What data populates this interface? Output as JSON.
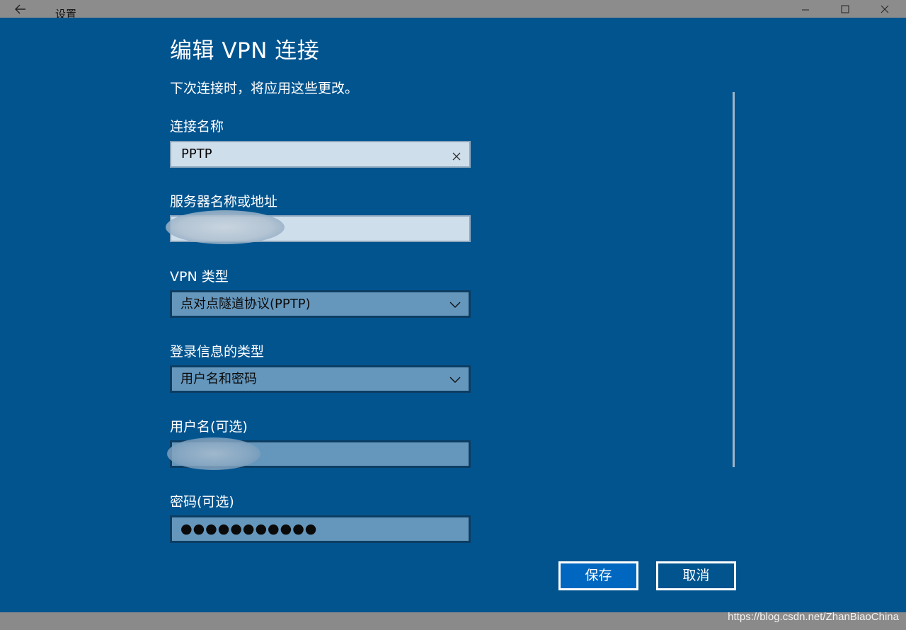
{
  "window": {
    "title": "设置",
    "back_icon": "arrow-left-icon",
    "controls": [
      "minimize-icon",
      "maximize-icon",
      "close-icon"
    ]
  },
  "dialog": {
    "title": "编辑 VPN 连接",
    "subtitle": "下次连接时，将应用这些更改。",
    "fields": {
      "connection_name": {
        "label": "连接名称",
        "value": "PPTP"
      },
      "server": {
        "label": "服务器名称或地址",
        "value": ""
      },
      "vpn_type": {
        "label": "VPN 类型",
        "value": "点对点隧道协议(PPTP)"
      },
      "signin_type": {
        "label": "登录信息的类型",
        "value": "用户名和密码"
      },
      "username": {
        "label": "用户名(可选)",
        "value": ""
      },
      "password": {
        "label": "密码(可选)",
        "value": "●●●●●●●●●●●"
      }
    },
    "buttons": {
      "save": "保存",
      "cancel": "取消"
    }
  },
  "watermark": "https://blog.csdn.net/ZhanBiaoChina",
  "colors": {
    "dialog_bg": "#02548f",
    "titlebar_bg": "#8c8c8c",
    "primary_button": "#0067c0",
    "input_light": "#cfdeeb",
    "input_dim": "#6597bd"
  }
}
